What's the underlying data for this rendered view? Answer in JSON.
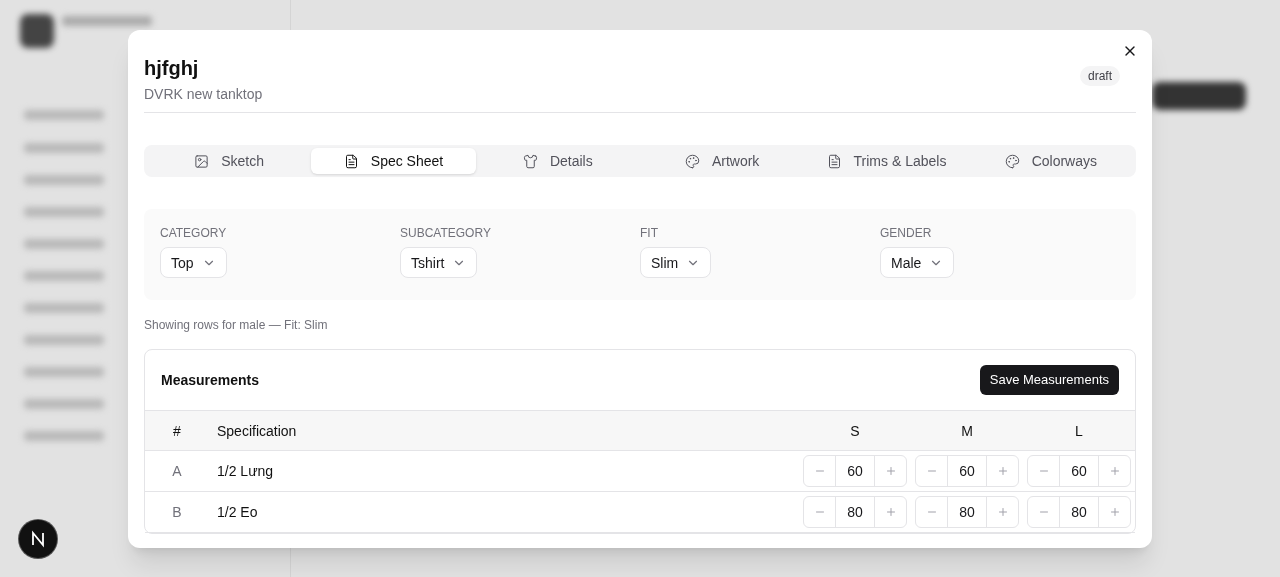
{
  "dialog": {
    "title": "hjfghj",
    "subtitle": "DVRK new tanktop",
    "status_badge": "draft"
  },
  "tabs": [
    {
      "label": "Sketch",
      "kind": "image",
      "selected": false
    },
    {
      "label": "Spec Sheet",
      "kind": "document",
      "selected": true
    },
    {
      "label": "Details",
      "kind": "shirt",
      "selected": false
    },
    {
      "label": "Artwork",
      "kind": "palette",
      "selected": false
    },
    {
      "label": "Trims & Labels",
      "kind": "document",
      "selected": false
    },
    {
      "label": "Colorways",
      "kind": "palette",
      "selected": false
    }
  ],
  "filters": [
    {
      "label": "CATEGORY",
      "value": "Top"
    },
    {
      "label": "SUBCATEGORY",
      "value": "Tshirt"
    },
    {
      "label": "FIT",
      "value": "Slim"
    },
    {
      "label": "GENDER",
      "value": "Male"
    }
  ],
  "summary": "Showing rows for male — Fit: Slim",
  "measurements": {
    "title": "Measurements",
    "save_button": "Save Measurements",
    "columns": [
      "#",
      "Specification",
      "S",
      "M",
      "L"
    ],
    "rows": [
      {
        "code": "A",
        "name": "1/2 Lưng",
        "values": [
          "60",
          "60",
          "60"
        ]
      },
      {
        "code": "B",
        "name": "1/2 Eo",
        "values": [
          "80",
          "80",
          "80"
        ]
      }
    ]
  }
}
